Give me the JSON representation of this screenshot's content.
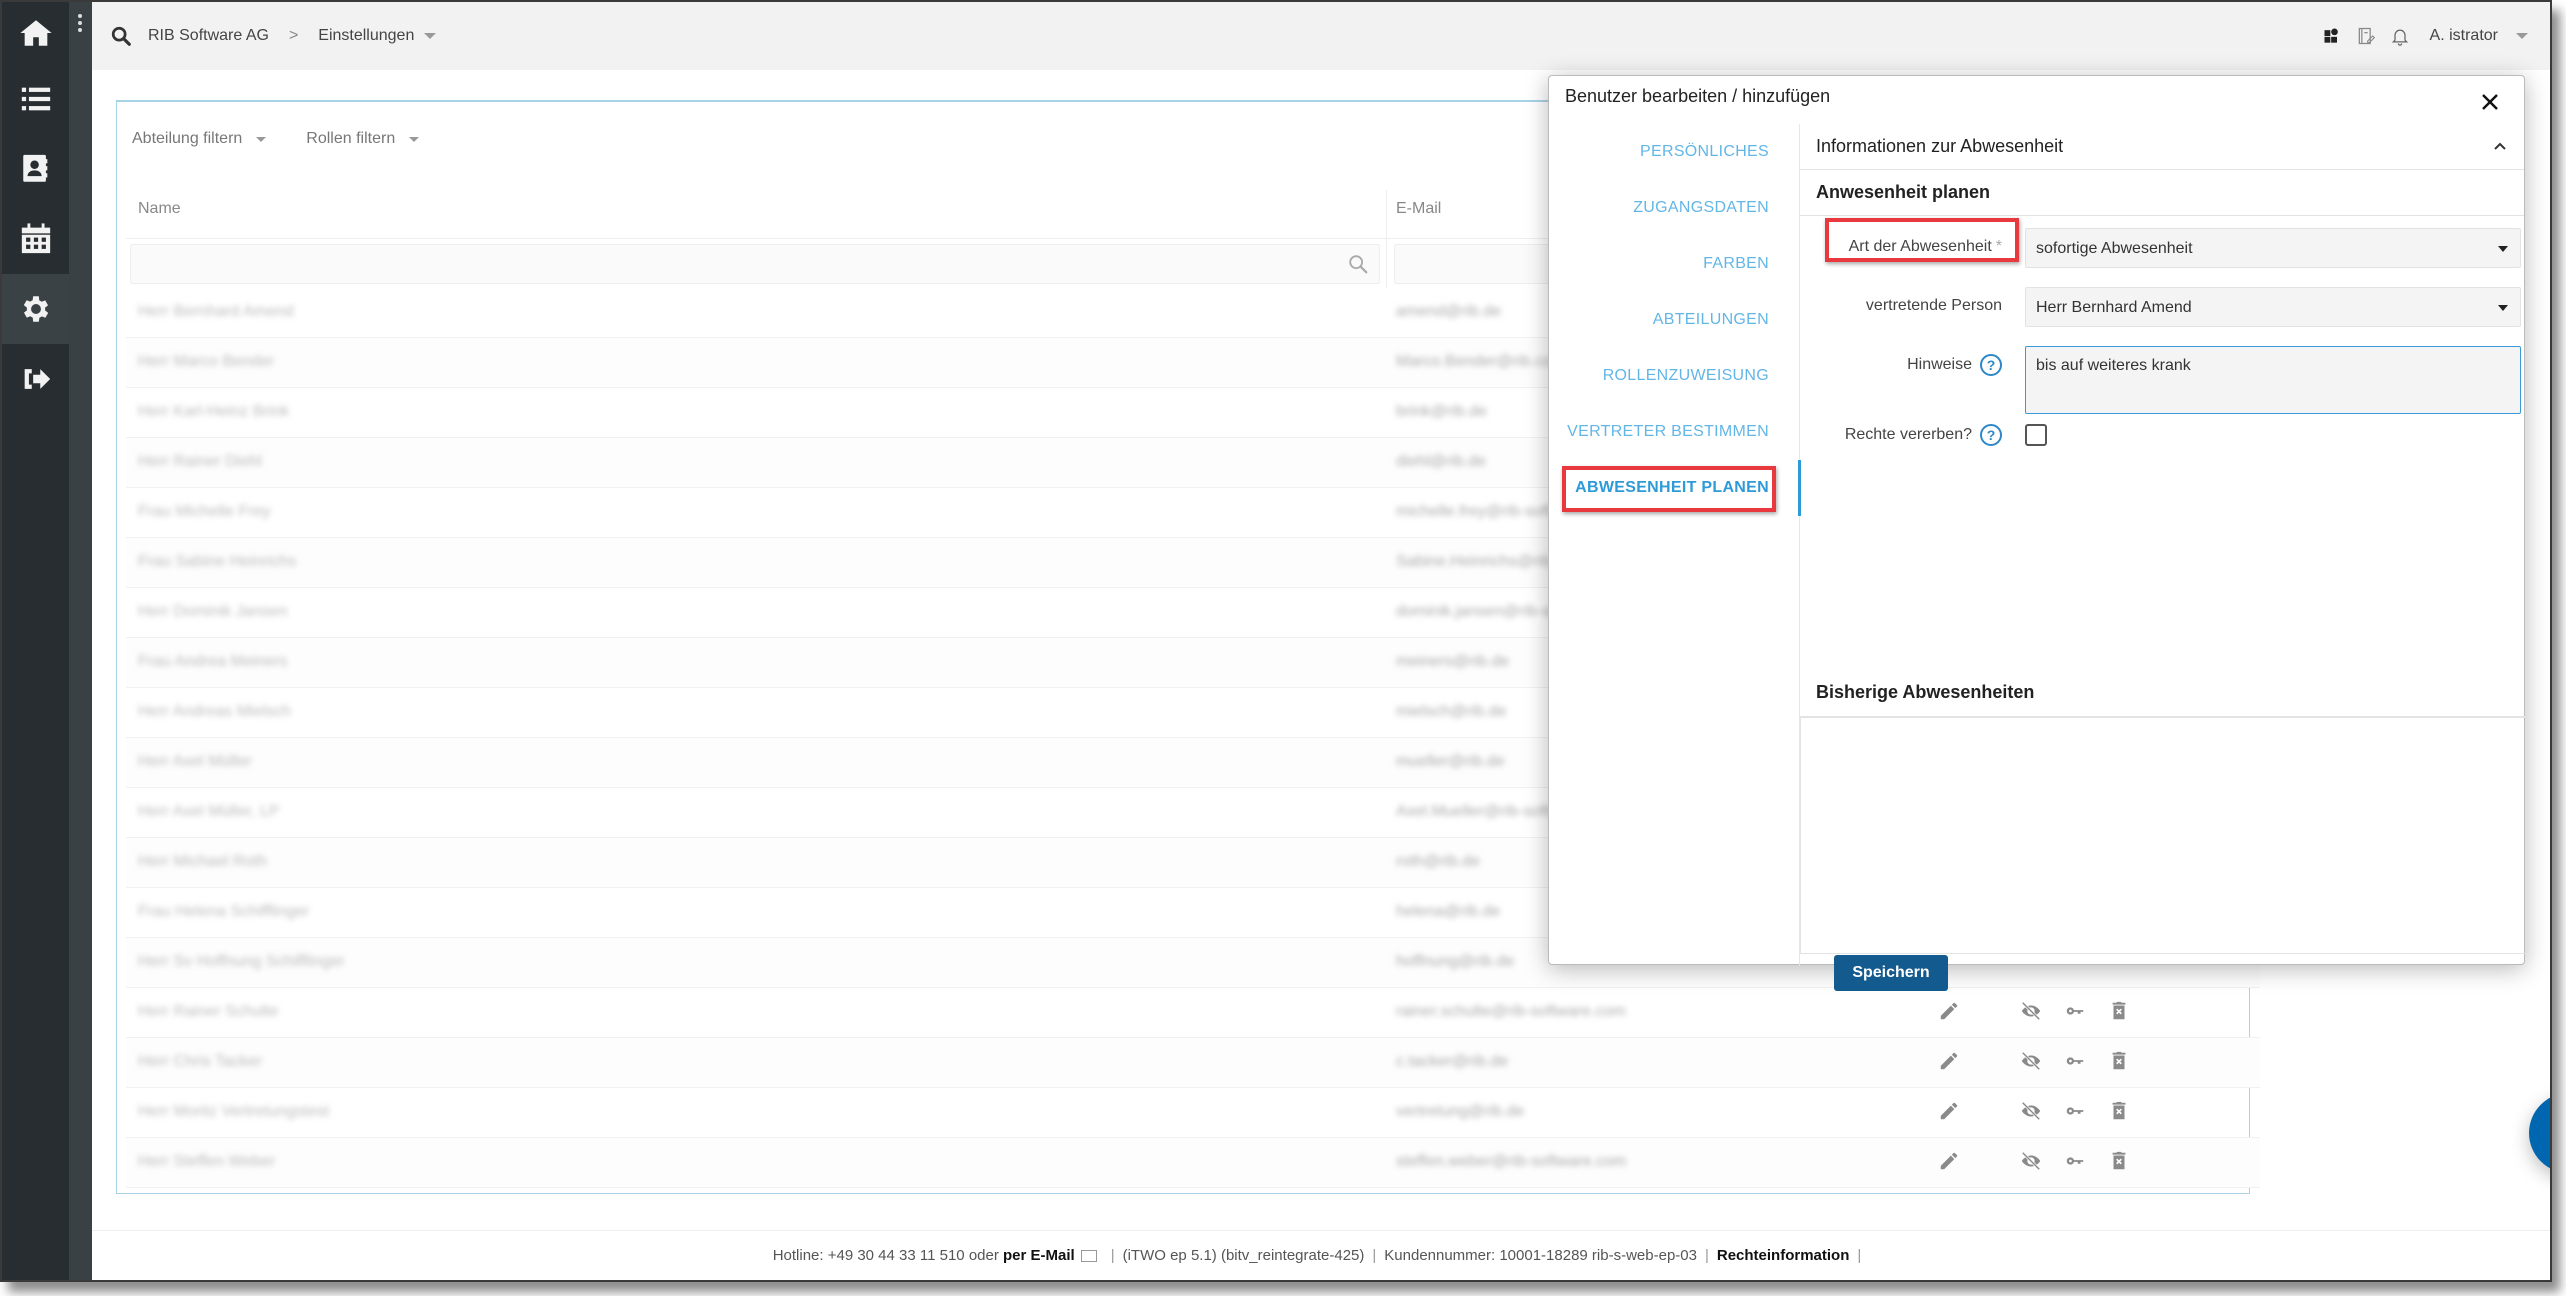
{
  "sidebar": {
    "items": [
      {
        "icon": "home-icon",
        "label": "Home"
      },
      {
        "icon": "list-icon",
        "label": "Liste"
      },
      {
        "icon": "contacts-icon",
        "label": "Kontakte"
      },
      {
        "icon": "calendar-icon",
        "label": "Kalender"
      },
      {
        "icon": "gear-icon",
        "label": "Einstellungen",
        "active": true
      },
      {
        "icon": "logout-icon",
        "label": "Abmelden"
      }
    ]
  },
  "header": {
    "breadcrumb": [
      "RIB Software AG",
      "Einstellungen"
    ],
    "breadcrumb_separator": ">",
    "user_name": "A. istrator",
    "icons": [
      "apps-icon",
      "notes-icon",
      "bell-icon"
    ]
  },
  "filters": {
    "department": "Abteilung filtern",
    "roles": "Rollen filtern"
  },
  "table": {
    "columns": [
      "Name",
      "E-Mail"
    ],
    "name_filter_placeholder": "",
    "email_filter_placeholder": "",
    "rows": [
      {
        "name": "Herr Bernhard Amend",
        "email": "amend@rib.de"
      },
      {
        "name": "Herr Marco Bender",
        "email": "Marco.Bender@rib.com"
      },
      {
        "name": "Herr Karl-Heinz Brink",
        "email": "brink@rib.de"
      },
      {
        "name": "Herr Rainer Diehl",
        "email": "diehl@rib.de"
      },
      {
        "name": "Frau Michelle Frey",
        "email": "michelle.frey@rib-software.de"
      },
      {
        "name": "Frau Sabine Heinrichs",
        "email": "Sabine.Heinrichs@rib-software.de"
      },
      {
        "name": "Herr Dominik Jansen",
        "email": "dominik.jansen@rib-software.de"
      },
      {
        "name": "Frau Andrea Meiners",
        "email": "meiners@rib.de"
      },
      {
        "name": "Herr Andreas Mielsch",
        "email": "mielsch@rib.de"
      },
      {
        "name": "Herr Axel Müller",
        "email": "mueller@rib.de"
      },
      {
        "name": "Herr Axel Müller, LP",
        "email": "Axel.Mueller@rib-software.de"
      },
      {
        "name": "Herr Michael Roth",
        "email": "roth@rib.de"
      },
      {
        "name": "Frau Helena Schifflinger",
        "email": "helena@rib.de"
      },
      {
        "name": "Herr Sv Hoffnung Schifflinger",
        "email": "hoffnung@rib.de"
      },
      {
        "name": "Herr Rainer Schulte",
        "email": "rainer.schulte@rib-software.com"
      },
      {
        "name": "Herr Chris Tacker",
        "email": "c.tacker@rib.de"
      },
      {
        "name": "Herr Moritz Vertretungstest",
        "email": "vertretung@rib.de"
      },
      {
        "name": "Herr Steffen Weber",
        "email": "steffen.weber@rib-software.com"
      }
    ],
    "row_actions": [
      "edit-icon",
      "visibility-off-icon",
      "key-icon",
      "delete-icon"
    ]
  },
  "modal": {
    "title": "Benutzer bearbeiten / hinzufügen",
    "nav": [
      {
        "label": "PERSÖNLICHES"
      },
      {
        "label": "ZUGANGSDATEN"
      },
      {
        "label": "FARBEN"
      },
      {
        "label": "ABTEILUNGEN"
      },
      {
        "label": "ROLLENZUWEISUNG"
      },
      {
        "label": "VERTRETER BESTIMMEN"
      },
      {
        "label": "ABWESENHEIT PLANEN",
        "active": true
      }
    ],
    "section_title": "Informationen zur Abwesenheit",
    "subsection_title": "Anwesenheit planen",
    "fields": {
      "absence_type": {
        "label": "Art der Abwesenheit",
        "required_marker": "*",
        "value": "sofortige Abwesenheit"
      },
      "substitute": {
        "label": "vertretende Person",
        "value": "Herr Bernhard Amend"
      },
      "notes": {
        "label": "Hinweise",
        "value": "bis auf weiteres krank",
        "help": "?"
      },
      "inherit_rights": {
        "label": "Rechte vererben?",
        "checked": false,
        "help": "?"
      }
    },
    "previous_title": "Bisherige Abwesenheiten",
    "save_label": "Speichern"
  },
  "footer": {
    "hotline": "Hotline: +49 30 44 33 11 510 oder",
    "email_link": "per E-Mail",
    "version": "(iTWO ep 5.1) (bitv_reintegrate-425)",
    "customer": "Kundennummer: 10001-18289 rib-s-web-ep-03",
    "legal_link": "Rechteinformation"
  },
  "colors": {
    "sidebar": "#272d30",
    "accent": "#2e9ad8",
    "save_button": "#135a8e",
    "highlight": "#e8393f",
    "chat": "#0066b0"
  }
}
